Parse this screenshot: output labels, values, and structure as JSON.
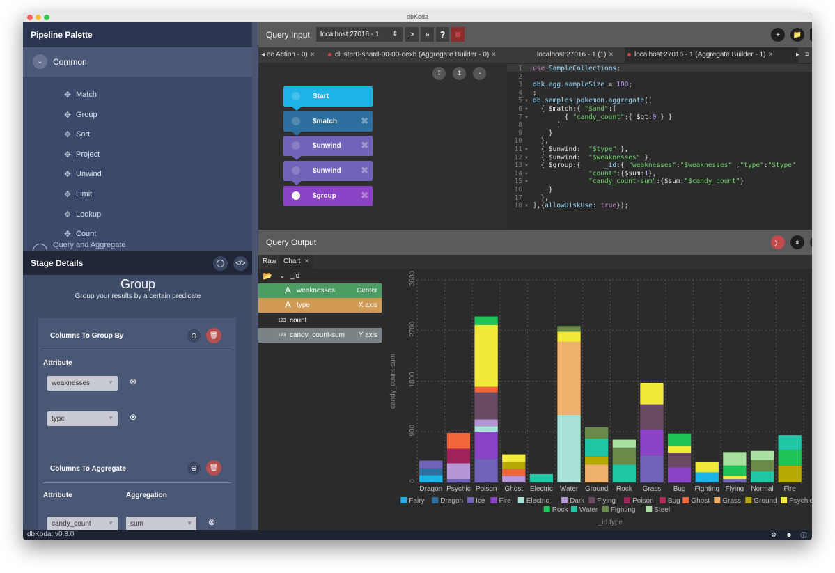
{
  "window": {
    "title": "dbKoda"
  },
  "palette": {
    "title": "Pipeline Palette",
    "section": "Common",
    "items": [
      "Match",
      "Group",
      "Sort",
      "Project",
      "Unwind",
      "Limit",
      "Lookup",
      "Count"
    ],
    "next_section": "Query and Aggregate"
  },
  "stage": {
    "title": "Stage Details",
    "name": "Group",
    "subtitle": "Group your results by a certain predicate",
    "group_by_title": "Columns To Group By",
    "attribute_label": "Attribute",
    "group_fields": [
      "weaknesses",
      "type"
    ],
    "aggregate_title": "Columns To Aggregate",
    "aggregation_label": "Aggregation",
    "agg_attribute": "candy_count",
    "agg_function": "sum"
  },
  "query_input": {
    "title": "Query Input",
    "connection": "localhost:27016 - 1"
  },
  "tabs": [
    {
      "label": "ee Action - 0)",
      "dot": false
    },
    {
      "label": "cluster0-shard-00-00-oexh (Aggregate Builder - 0)",
      "dot": true
    },
    {
      "label": "localhost:27016 - 1 (1)",
      "dot": false
    },
    {
      "label": "localhost:27016 - 1 (Aggregate Builder - 1)",
      "dot": true
    }
  ],
  "pipeline_blocks": [
    {
      "label": "Start",
      "color": "#1db3e6"
    },
    {
      "label": "$match",
      "color": "#2d6f9e"
    },
    {
      "label": "$unwind",
      "color": "#7163b8"
    },
    {
      "label": "$unwind",
      "color": "#7163b8"
    },
    {
      "label": "$group",
      "color": "#8a43c4"
    }
  ],
  "code_lines": [
    "use SampleCollections;",
    "",
    "dbk_agg.sampleSize = 100;",
    ";",
    "db.samples_pokemon.aggregate([",
    "  { $match:{ \"$and\":[",
    "        { \"candy_count\":{ $gt:0 } }",
    "      ]",
    "    }",
    "  },",
    "  { $unwind:  \"$type\" },",
    "  { $unwind:  \"$weaknesses\" },",
    "  { $group:{      _id:{ \"weaknesses\":\"$weaknesses\" ,\"type\":\"$type\"",
    "              \"count\":{$sum:1},",
    "              \"candy_count-sum\":{$sum:\"$candy_count\"}",
    "    }",
    "  },",
    "],{allowDiskUse: true});"
  ],
  "query_output": {
    "title": "Query Output",
    "tabs": [
      "Raw",
      "Chart"
    ]
  },
  "fields": {
    "root": "_id",
    "rows": [
      {
        "name": "weaknesses",
        "axis": "Center",
        "bg": "#4b9b63"
      },
      {
        "name": "type",
        "axis": "X axis",
        "bg": "#d09a55"
      },
      {
        "name": "count",
        "axis": "",
        "bg": "#2b2b2b"
      },
      {
        "name": "candy_count-sum",
        "axis": "Y axis",
        "bg": "#7a8386"
      }
    ]
  },
  "statusbar": {
    "version": "dbKoda: v0.8.0"
  },
  "chart_data": {
    "type": "bar",
    "stacked": true,
    "xlabel": "_id.type",
    "ylabel": "candy_count-sum",
    "ylim": [
      0,
      3600
    ],
    "yticks": [
      0,
      900,
      1800,
      2700,
      3600
    ],
    "grid": true,
    "legend": "bottom",
    "categories": [
      "Dragon",
      "Psychic",
      "Poison",
      "Ghost",
      "Electric",
      "Water",
      "Ground",
      "Rock",
      "Grass",
      "Bug",
      "Fighting",
      "Flying",
      "Normal",
      "Fire"
    ],
    "series": [
      {
        "name": "Fairy",
        "color": "#1db3e6",
        "values": [
          130,
          0,
          0,
          0,
          0,
          0,
          0,
          0,
          0,
          0,
          180,
          0,
          0,
          0
        ]
      },
      {
        "name": "Dragon",
        "color": "#2d6f9e",
        "values": [
          120,
          0,
          0,
          0,
          0,
          0,
          0,
          0,
          0,
          0,
          0,
          0,
          0,
          0
        ]
      },
      {
        "name": "Ice",
        "color": "#7163b8",
        "values": [
          140,
          60,
          420,
          0,
          0,
          0,
          0,
          0,
          480,
          0,
          0,
          60,
          0,
          0
        ]
      },
      {
        "name": "Fire",
        "color": "#8a43c4",
        "values": [
          0,
          0,
          480,
          0,
          0,
          0,
          0,
          0,
          460,
          270,
          0,
          0,
          0,
          0
        ]
      },
      {
        "name": "Electric",
        "color": "#a8e1d6",
        "values": [
          0,
          0,
          100,
          0,
          0,
          1200,
          0,
          0,
          0,
          0,
          0,
          0,
          0,
          0
        ]
      },
      {
        "name": "Dark",
        "color": "#b696d6",
        "values": [
          0,
          280,
          120,
          120,
          0,
          0,
          0,
          0,
          0,
          0,
          0,
          0,
          0,
          0
        ]
      },
      {
        "name": "Flying",
        "color": "#6a4a63",
        "values": [
          0,
          0,
          480,
          0,
          0,
          0,
          0,
          0,
          450,
          260,
          0,
          0,
          0,
          0
        ]
      },
      {
        "name": "Poison",
        "color": "#a0245a",
        "values": [
          0,
          260,
          0,
          0,
          0,
          0,
          0,
          0,
          0,
          0,
          0,
          0,
          0,
          0
        ]
      },
      {
        "name": "Bug",
        "color": "#b02a55",
        "values": [
          0,
          0,
          0,
          0,
          0,
          0,
          0,
          0,
          0,
          0,
          0,
          0,
          0,
          0
        ]
      },
      {
        "name": "Ghost",
        "color": "#f0653a",
        "values": [
          0,
          280,
          100,
          120,
          0,
          0,
          0,
          0,
          0,
          0,
          0,
          0,
          0,
          0
        ]
      },
      {
        "name": "Grass",
        "color": "#efb06a",
        "values": [
          0,
          0,
          0,
          0,
          0,
          1300,
          320,
          0,
          0,
          0,
          0,
          0,
          0,
          0
        ]
      },
      {
        "name": "Ground",
        "color": "#b5a800",
        "values": [
          0,
          0,
          0,
          130,
          0,
          0,
          140,
          0,
          0,
          0,
          0,
          0,
          0,
          300
        ]
      },
      {
        "name": "Psychic",
        "color": "#f2ea3a",
        "values": [
          0,
          0,
          1100,
          130,
          0,
          180,
          0,
          0,
          380,
          120,
          180,
          60,
          0,
          0
        ]
      },
      {
        "name": "Rock",
        "color": "#1ec65a",
        "values": [
          0,
          0,
          150,
          0,
          0,
          0,
          0,
          0,
          0,
          220,
          0,
          180,
          0,
          280
        ]
      },
      {
        "name": "Water",
        "color": "#1ec6a6",
        "values": [
          0,
          0,
          0,
          0,
          150,
          0,
          320,
          320,
          0,
          0,
          0,
          0,
          200,
          260
        ]
      },
      {
        "name": "Fighting",
        "color": "#6a8a4a",
        "values": [
          0,
          0,
          0,
          0,
          0,
          100,
          200,
          300,
          0,
          0,
          0,
          0,
          200,
          0
        ]
      },
      {
        "name": "Steel",
        "color": "#a8e1a0",
        "values": [
          0,
          0,
          0,
          0,
          0,
          0,
          0,
          140,
          0,
          0,
          0,
          240,
          160,
          0
        ]
      }
    ]
  }
}
